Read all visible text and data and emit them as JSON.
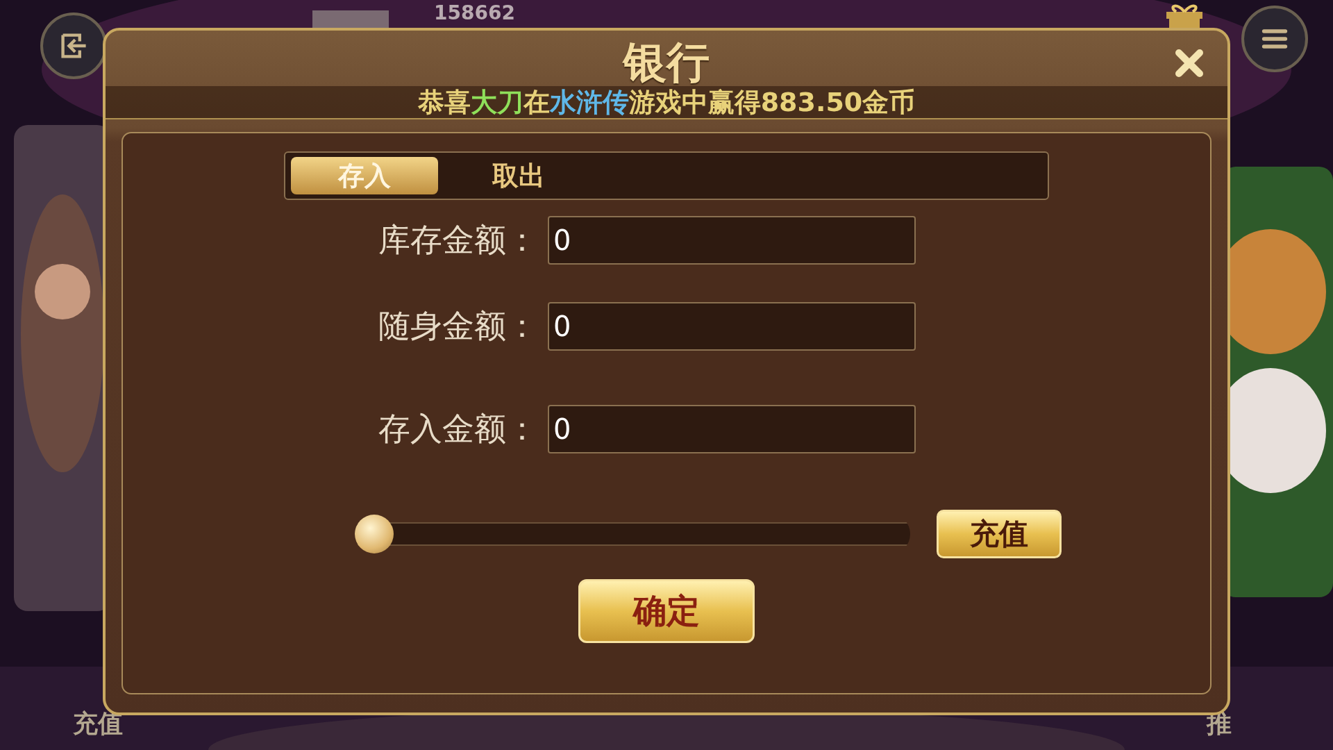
{
  "background": {
    "score": "158662",
    "left_button": "充值",
    "right_button": "推"
  },
  "dialog": {
    "title": "银行",
    "marquee": [
      {
        "text": "恭喜",
        "kind": "plain"
      },
      {
        "text": "大刀",
        "kind": "player"
      },
      {
        "text": "在",
        "kind": "plain"
      },
      {
        "text": "水浒传",
        "kind": "game"
      },
      {
        "text": "游戏中赢得883.50金币",
        "kind": "plain"
      }
    ],
    "tabs": [
      {
        "label": "存入",
        "selected": true
      },
      {
        "label": "取出",
        "selected": false
      }
    ],
    "fields": [
      {
        "label": "库存金额：",
        "value": "0"
      },
      {
        "label": "随身金额：",
        "value": "0"
      },
      {
        "label": "存入金额：",
        "value": "0"
      }
    ],
    "slider": {
      "level": 0
    },
    "recharge_button": "充值",
    "confirm_button": "确定"
  }
}
